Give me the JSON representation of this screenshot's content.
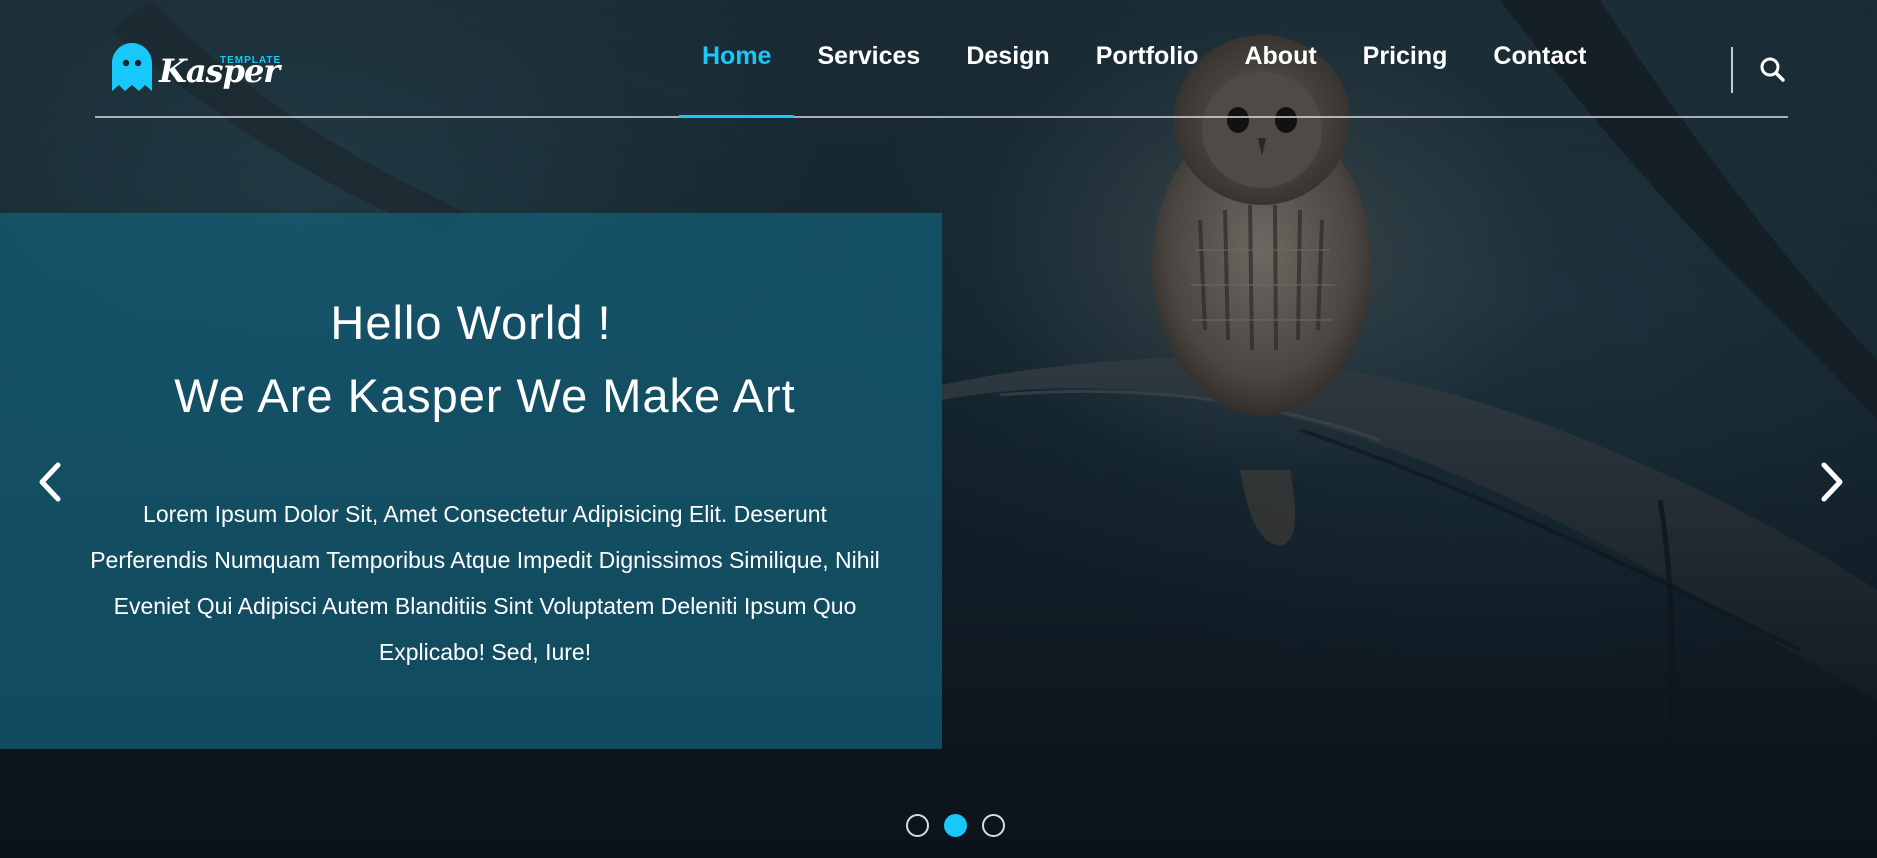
{
  "colors": {
    "accent": "#19c8fa",
    "panel": "#135f78",
    "text": "#ffffff"
  },
  "logo": {
    "tag": "TEMPLATE",
    "name": "Kasper",
    "icon": "ghost-icon"
  },
  "nav": {
    "items": [
      {
        "label": "Home",
        "active": true
      },
      {
        "label": "Services",
        "active": false
      },
      {
        "label": "Design",
        "active": false
      },
      {
        "label": "Portfolio",
        "active": false
      },
      {
        "label": "About",
        "active": false
      },
      {
        "label": "Pricing",
        "active": false
      },
      {
        "label": "Contact",
        "active": false
      }
    ],
    "search_icon": "search-icon"
  },
  "hero": {
    "greeting": "Hello World !",
    "tagline": "We Are Kasper We Make Art",
    "description": "Lorem Ipsum Dolor Sit, Amet Consectetur Adipisicing Elit. Deserunt Perferendis Numquam Temporibus Atque Impedit Dignissimos Similique, Nihil Eveniet Qui Adipisci Autem Blanditiis Sint Voluptatem Deleniti Ipsum Quo Explicabo! Sed, Iure!"
  },
  "slider": {
    "prev_icon": "chevron-left-icon",
    "next_icon": "chevron-right-icon",
    "slide_count": 3,
    "active_slide": 2
  }
}
